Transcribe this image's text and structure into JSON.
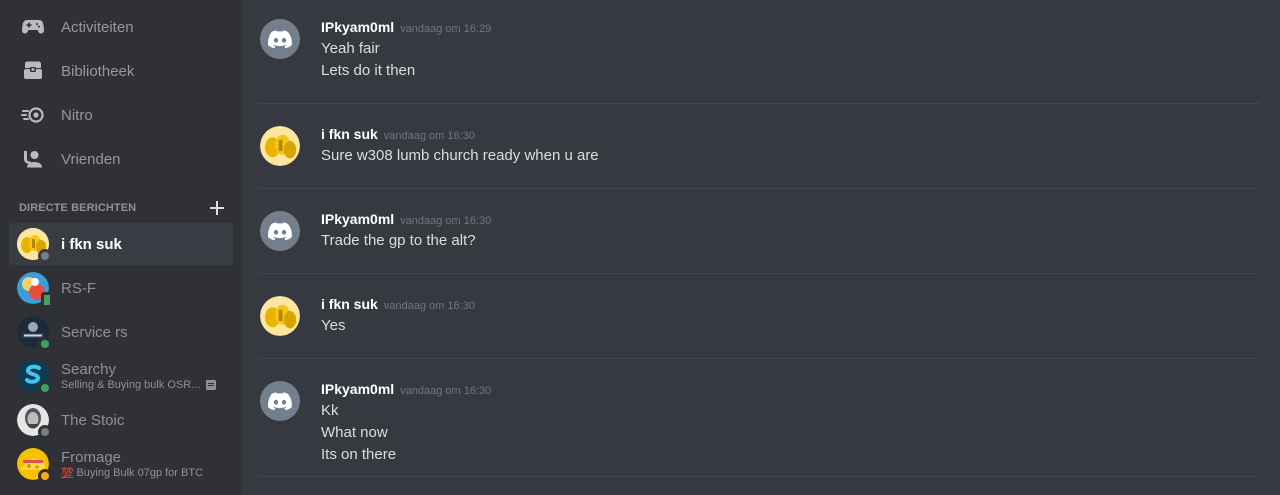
{
  "sidebar": {
    "nav": [
      {
        "label": "Activiteiten",
        "icon": "game-controller-icon"
      },
      {
        "label": "Bibliotheek",
        "icon": "library-icon"
      },
      {
        "label": "Nitro",
        "icon": "nitro-icon"
      },
      {
        "label": "Vrienden",
        "icon": "friends-icon"
      }
    ],
    "dm_header": "DIRECTE BERICHTEN",
    "dm_add_icon": "plus-icon",
    "dms": [
      {
        "name": "i fkn suk",
        "status": "offline",
        "active": true
      },
      {
        "name": "RS-F",
        "status": "mobile"
      },
      {
        "name": "Service rs",
        "status": "online"
      },
      {
        "name": "Searchy",
        "status": "online",
        "activity": "Selling & Buying bulk OSR..."
      },
      {
        "name": "The Stoic",
        "status": "offline"
      },
      {
        "name": "Fromage",
        "status": "idle",
        "activity": "Buying Bulk 07gp for BTC",
        "emoji": "💯"
      }
    ]
  },
  "chat": {
    "messages": [
      {
        "author": "IPkyam0ml",
        "time": "vandaag om 16:29",
        "avatar": "discord-logo-icon",
        "lines": [
          "Yeah fair",
          "Lets do it then"
        ]
      },
      {
        "author": "i fkn suk",
        "time": "vandaag om 16:30",
        "avatar": "gold-coins-avatar",
        "lines": [
          "Sure w308 lumb church ready when u are"
        ]
      },
      {
        "author": "IPkyam0ml",
        "time": "vandaag om 16:30",
        "avatar": "discord-logo-icon",
        "lines": [
          "Trade the gp to the alt?"
        ]
      },
      {
        "author": "i fkn suk",
        "time": "vandaag om 16:30",
        "avatar": "gold-coins-avatar",
        "lines": [
          "Yes"
        ]
      },
      {
        "author": "IPkyam0ml",
        "time": "vandaag om 16:30",
        "avatar": "discord-logo-icon",
        "lines": [
          "Kk",
          "What now",
          "Its on there"
        ]
      }
    ]
  },
  "colors": {
    "sidebar_bg": "#2f3136",
    "chat_bg": "#36393f",
    "active_item": "#393c43",
    "online": "#3ba55d",
    "idle": "#faa81a",
    "offline": "#747f8d"
  }
}
